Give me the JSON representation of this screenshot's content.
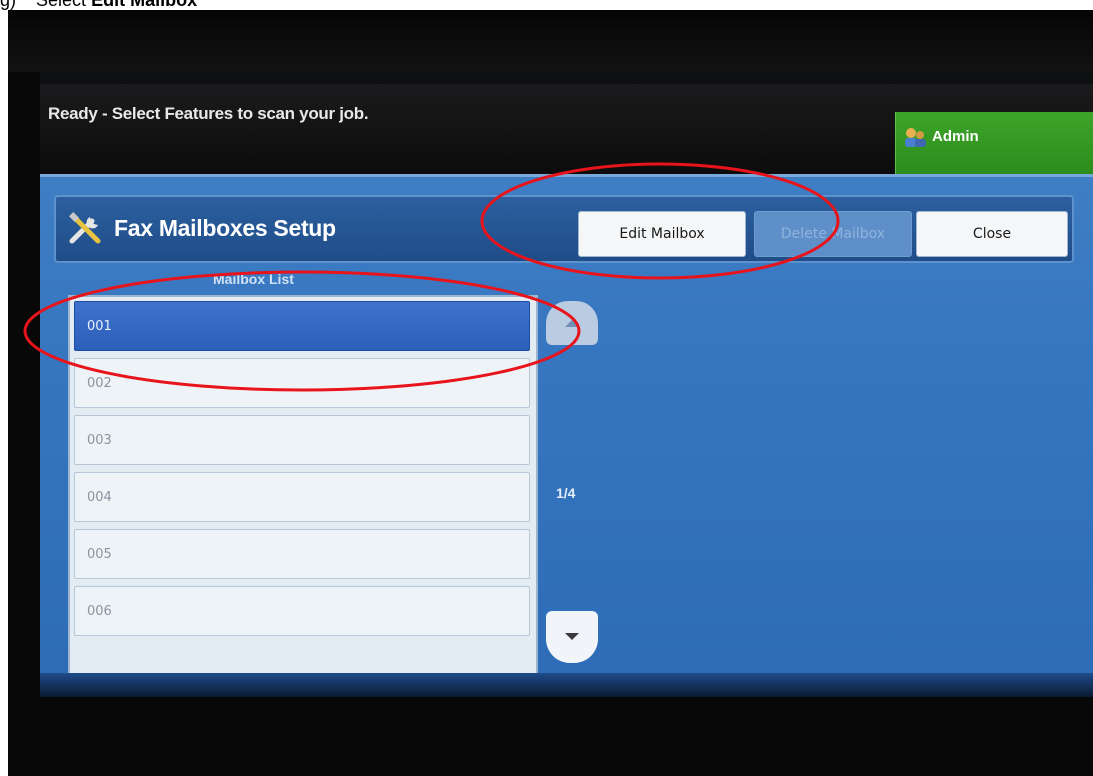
{
  "caption": {
    "prefix": "g)",
    "text": "Select",
    "bold": "Edit Mailbox"
  },
  "status": {
    "message": "Ready - Select Features to scan your job.",
    "admin_label": "Admin"
  },
  "dialog": {
    "title": "Fax Mailboxes Setup",
    "buttons": {
      "edit": "Edit Mailbox",
      "delete": "Delete Mailbox",
      "close": "Close"
    },
    "list_header": "Mailbox List",
    "mailboxes": [
      "001",
      "002",
      "003",
      "004",
      "005",
      "006"
    ],
    "selected_index": 0,
    "page_indicator": "1/4"
  },
  "icons": {
    "admin": "admin-user-icon",
    "title": "tools-icon",
    "scroll_up": "arrow-up-icon",
    "scroll_down": "arrow-down-icon"
  },
  "colors": {
    "annotation": "#e8141c",
    "panel": "#3676c0",
    "admin_green": "#3da42a",
    "selected_row": "#3e72cc"
  }
}
